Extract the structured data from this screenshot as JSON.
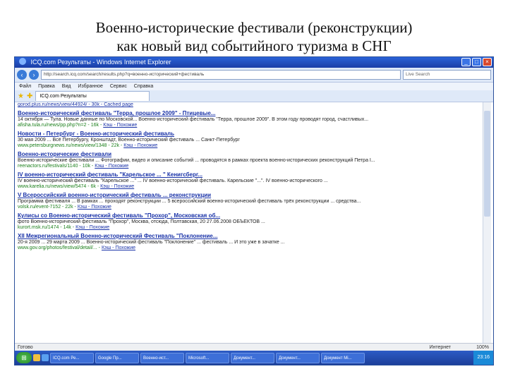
{
  "slide": {
    "title_line1": "Военно-исторические фестивали (реконструкции)",
    "title_line2": "как новый вид событийного туризма в СНГ"
  },
  "browser": {
    "window_title": "ICQ.com Результаты - Windows Internet Explorer",
    "address": "http://search.icq.com/search/results.php?q=военно-исторический+фестиваль",
    "search_placeholder": "Live Search",
    "menu": [
      "Файл",
      "Правка",
      "Вид",
      "Избранное",
      "Сервис",
      "Справка"
    ],
    "tab_label": "ICQ.com Результаты"
  },
  "results": [
    {
      "url_prefix": "gorod.plus.ru/news/view/44924/ - 30k - ",
      "cache": "Cached page",
      "title": "",
      "snippet": ""
    },
    {
      "title": "Военно-исторический фестиваль \"Терра, прошлое 2009\" - Птицевые...",
      "snippet": "14 октября — Тула. Новые данные по Московской... Военно-исторический фестиваль \"Терра, прошлое 2009\". В этом году проводят город, счастливых...",
      "url_prefix": "afisha.tula.ru/news/pp.php?n=2 - 16k - ",
      "cache": "Кэш - Похожие"
    },
    {
      "title": "Новости - Петербург - Военно-исторический фестиваль",
      "snippet": "30 мая 2009 ... Всё Петербургу, Кронштадт, Военно-исторический фестиваль ... Санкт-Петербург",
      "url_prefix": "www.petersburgnews.ru/news/view/1348 - 22k - ",
      "cache": "Кэш - Похожие"
    },
    {
      "title": "Военно-исторические фестивали",
      "snippet": "Военно-исторические фестивали ... Фотографии, видео и описание событий ... проводятся в рамках проекта военно-исторических реконструкций Петра I...",
      "url_prefix": "reenactors.ru/festivals/1140 - 10k - ",
      "cache": "Кэш - Похожие"
    },
    {
      "title": "IV военно-исторический фестиваль \"Карельское ... \" Кенигсберг...",
      "snippet": "IV военно-исторический фестиваль \"Карельское ...\" ... IV военно-исторический фестиваль. Карельские \"...\". IV военно-исторического ...",
      "url_prefix": "www.karelia.ru/news/view/5474 - 6k - ",
      "cache": "Кэш - Похожие"
    },
    {
      "title": "V Всероссийский военно-исторический фестиваль ... реконструкции",
      "snippet": "Программа фестиваля ... В рамках ... проходят реконструкции ... 5 всероссийский военно-исторический фестиваль трёх реконструкции ... средства...",
      "url_prefix": "volsk.ru/event-7152 - 22k - ",
      "cache": "Кэш - Похожие"
    },
    {
      "title": "Кулисы со Военно-исторический фестиваль \"Прохор\", Московская об...",
      "snippet": "фото Военно-исторический фестиваль \"Прохор\", Москва, отсюда, Полтавская, 20 27.06.2008 ОБЪЕКТОВ ...",
      "url_prefix": "kurort.msk.ru/1474 - 14k - ",
      "cache": "Кэш - Похожие"
    },
    {
      "title": "XII Межрегиональный Военно-исторический Фестиваль \"Поклонение...",
      "snippet": "20-я 2009 ... 29 марта 2009 ... Военно-исторический фестиваль \"Поклонение\" ... фестиваль ... И это уже в зачатке ...",
      "url_prefix": "www.gov.org/photos/festival/detail/... - ",
      "cache": "Кэш - Похожие"
    }
  ],
  "status": {
    "left": "Готово",
    "zone": "Интернет",
    "zoom": "100%"
  },
  "taskbar": {
    "start": "⊞",
    "tasks": [
      "ICQ.com Ре...",
      "Google Пр...",
      "Военно-ист...",
      "Microsoft...",
      "Документ...",
      "Документ...",
      "Документ Mi..."
    ],
    "clock": "23:16"
  }
}
